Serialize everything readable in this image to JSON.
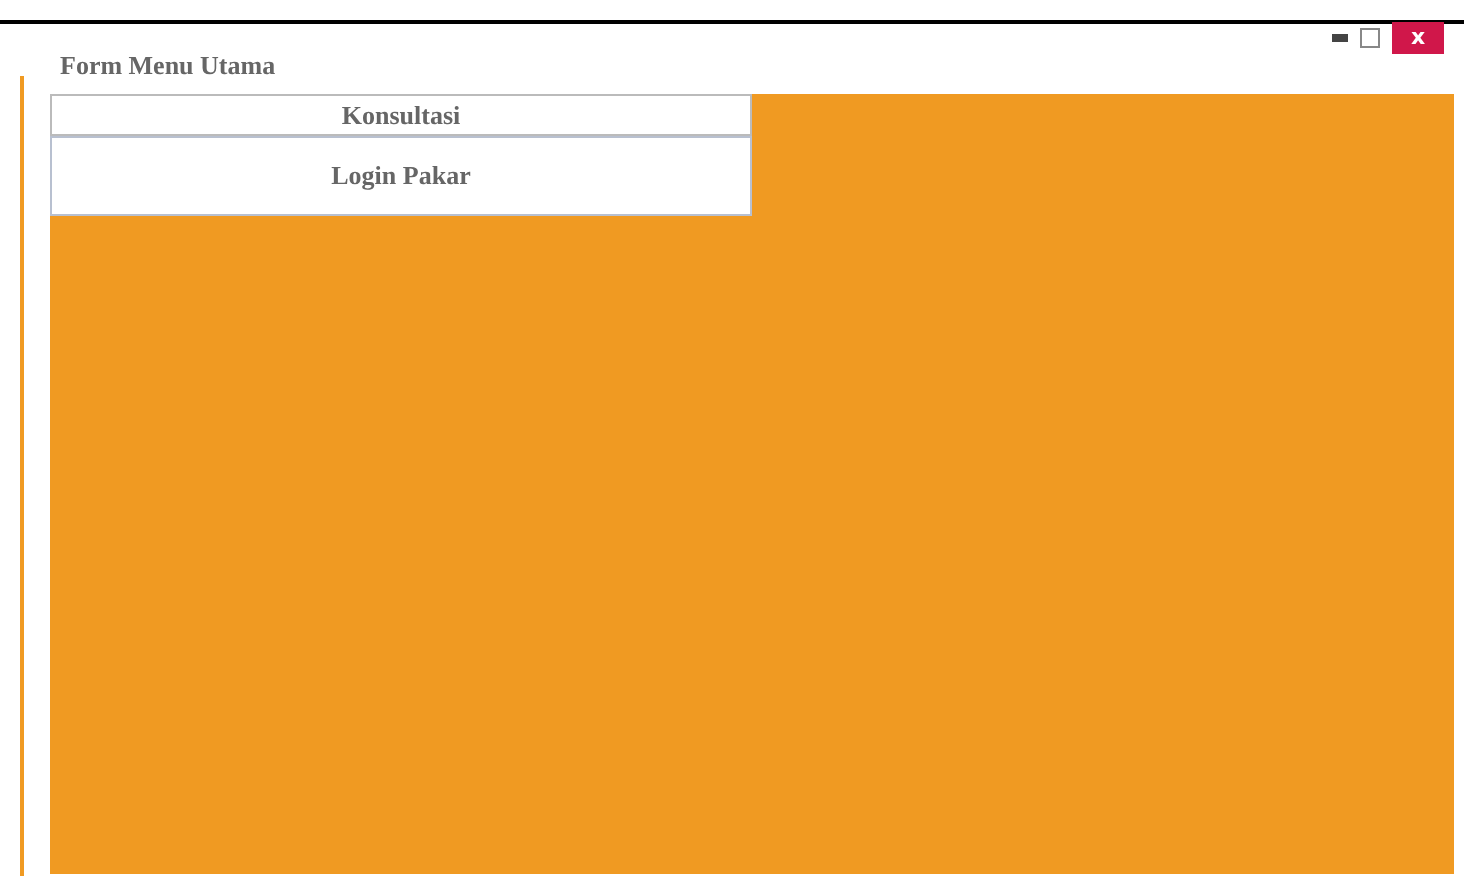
{
  "window": {
    "title": "Form Menu Utama",
    "close_label": "x"
  },
  "menu": [
    {
      "label": "Konsultasi"
    },
    {
      "label": "Login Pakar"
    }
  ]
}
